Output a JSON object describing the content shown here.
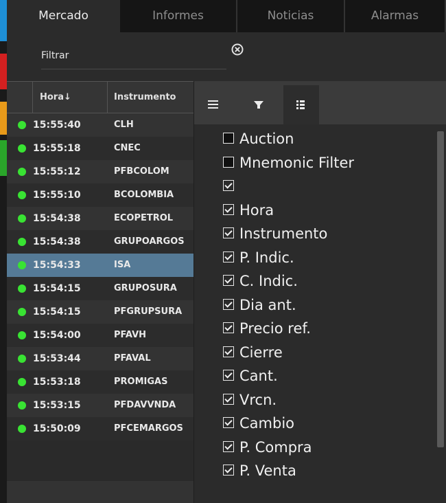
{
  "tabs": [
    "Mercado",
    "Informes",
    "Noticias",
    "Alarmas"
  ],
  "filter": {
    "placeholder": "Filtrar",
    "clear_icon": "clear-circle-icon"
  },
  "accent_colors": [
    "#1e8fd6",
    "#d32020",
    "#e89a1a",
    "#2aa52a"
  ],
  "table": {
    "headers": {
      "time": "Hora",
      "sort": "↓",
      "instrument": "Instrumento"
    },
    "rows": [
      {
        "time": "15:55:40",
        "instrument": "CLH"
      },
      {
        "time": "15:55:18",
        "instrument": "CNEC"
      },
      {
        "time": "15:55:12",
        "instrument": "PFBCOLOM"
      },
      {
        "time": "15:55:10",
        "instrument": "BCOLOMBIA"
      },
      {
        "time": "15:54:38",
        "instrument": "ECOPETROL"
      },
      {
        "time": "15:54:38",
        "instrument": "GRUPOARGOS"
      },
      {
        "time": "15:54:33",
        "instrument": "ISA"
      },
      {
        "time": "15:54:15",
        "instrument": "GRUPOSURA"
      },
      {
        "time": "15:54:15",
        "instrument": "PFGRUPSURA"
      },
      {
        "time": "15:54:00",
        "instrument": "PFAVH"
      },
      {
        "time": "15:53:44",
        "instrument": "PFAVAL"
      },
      {
        "time": "15:53:18",
        "instrument": "PROMIGAS"
      },
      {
        "time": "15:53:15",
        "instrument": "PFDAVVNDA"
      },
      {
        "time": "15:50:09",
        "instrument": "PFCEMARGOS"
      }
    ],
    "selected_index": 6
  },
  "panel": {
    "tab_icons": [
      "menu-icon",
      "filter-icon",
      "columns-icon"
    ],
    "columns": [
      {
        "label": "Auction",
        "checked": false
      },
      {
        "label": "Mnemonic Filter",
        "checked": false
      },
      {
        "label": "",
        "checked": true
      },
      {
        "label": "Hora",
        "checked": true
      },
      {
        "label": "Instrumento",
        "checked": true
      },
      {
        "label": "P. Indic.",
        "checked": true
      },
      {
        "label": "C. Indic.",
        "checked": true
      },
      {
        "label": "Dia ant.",
        "checked": true
      },
      {
        "label": "Precio ref.",
        "checked": true
      },
      {
        "label": "Cierre",
        "checked": true
      },
      {
        "label": "Cant.",
        "checked": true
      },
      {
        "label": "Vrcn.",
        "checked": true
      },
      {
        "label": "Cambio",
        "checked": true
      },
      {
        "label": "P. Compra",
        "checked": true
      },
      {
        "label": "P. Venta",
        "checked": true
      }
    ]
  }
}
